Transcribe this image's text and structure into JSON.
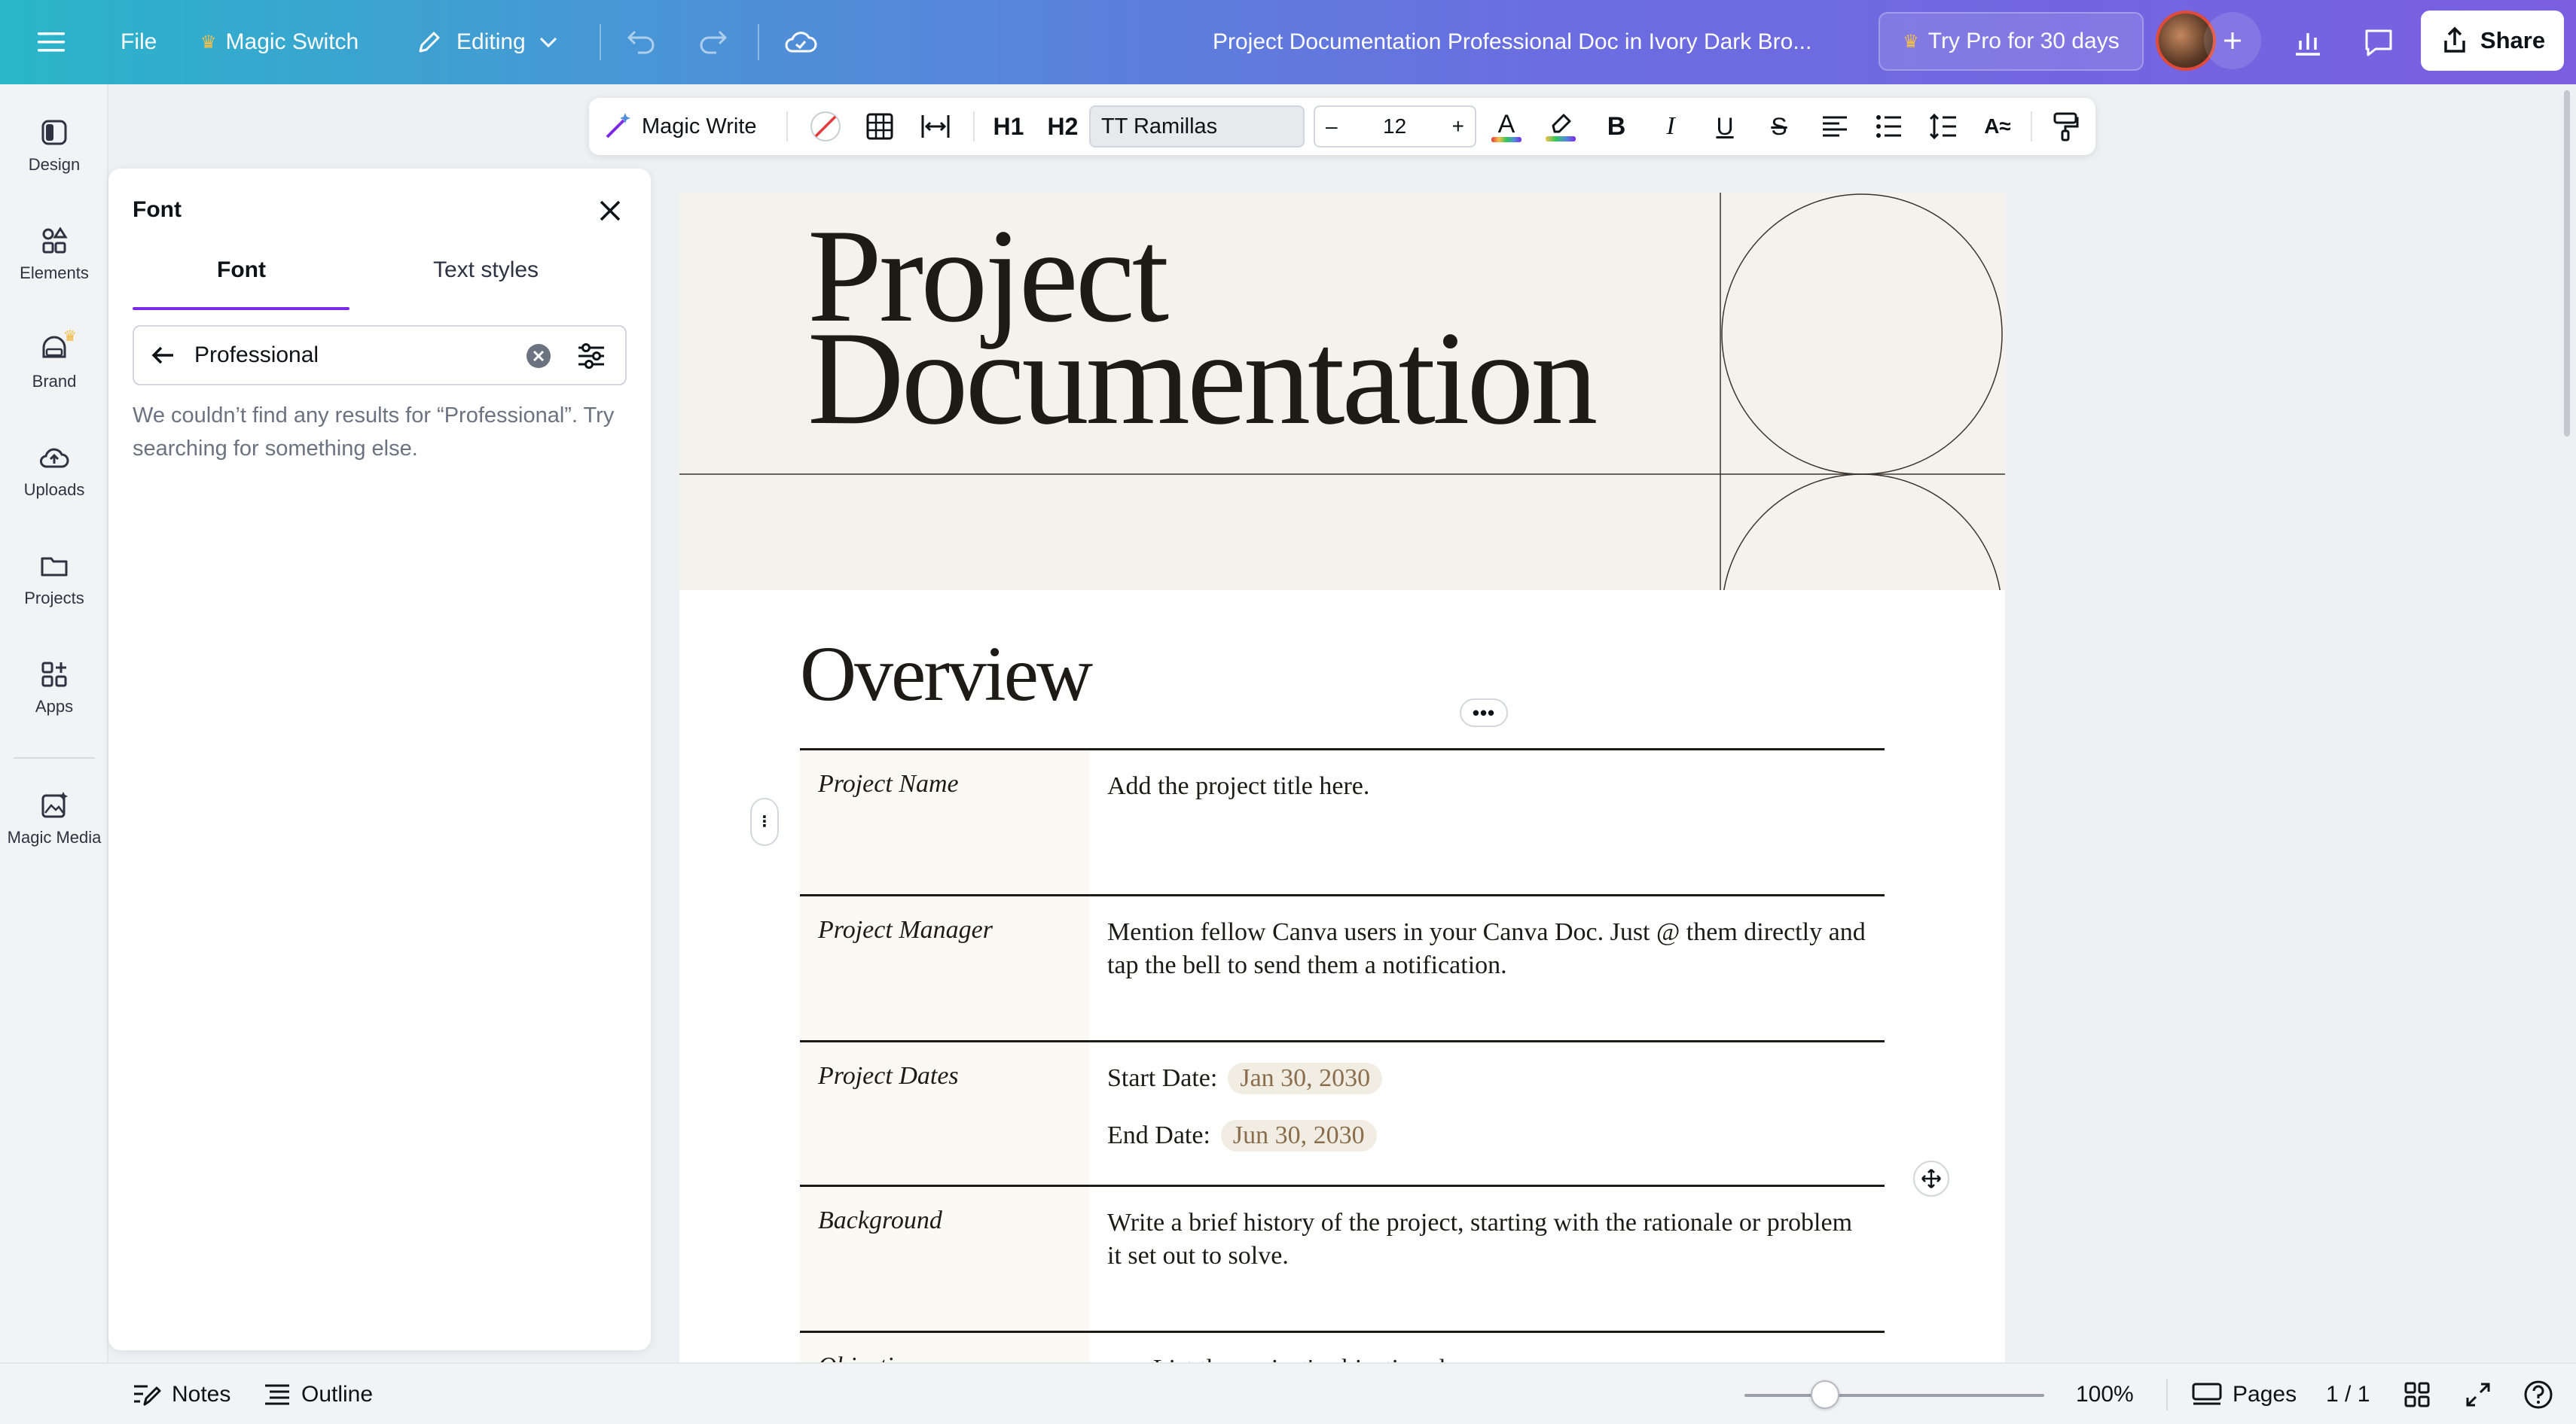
{
  "topbar": {
    "file_label": "File",
    "magic_switch_label": "Magic Switch",
    "editing_label": "Editing",
    "doc_title": "Project Documentation Professional Doc in Ivory Dark Bro...",
    "try_pro_label": "Try Pro for 30 days",
    "share_label": "Share"
  },
  "rail": {
    "items": [
      {
        "label": "Design",
        "icon": "design-icon"
      },
      {
        "label": "Elements",
        "icon": "elements-icon"
      },
      {
        "label": "Brand",
        "icon": "brand-icon"
      },
      {
        "label": "Uploads",
        "icon": "uploads-icon"
      },
      {
        "label": "Projects",
        "icon": "projects-icon"
      },
      {
        "label": "Apps",
        "icon": "apps-icon"
      },
      {
        "label": "Magic Media",
        "icon": "magic-media-icon"
      }
    ]
  },
  "font_panel": {
    "title": "Font",
    "tabs": [
      {
        "label": "Font",
        "active": true
      },
      {
        "label": "Text styles",
        "active": false
      }
    ],
    "search_value": "Professional",
    "no_results_message": "We couldn’t find any results for “Professional”. Try searching for something else."
  },
  "format_toolbar": {
    "magic_write_label": "Magic Write",
    "font_name": "TT Ramillas",
    "font_size": "12",
    "size_minus": "–",
    "size_plus": "+",
    "h1_label": "H1",
    "h2_label": "H2"
  },
  "document": {
    "hero_title_line1": "Project",
    "hero_title_line2": "Documentation",
    "overview_heading": "Overview",
    "rows": [
      {
        "label": "Project Name",
        "text": "Add the project title here."
      },
      {
        "label": "Project Manager",
        "text": "Mention fellow Canva users in your Canva Doc. Just @ them directly and tap the bell to send them a notification."
      },
      {
        "label": "Project Dates",
        "start_label": "Start Date:",
        "start_value": "Jan 30, 2030",
        "end_label": "End Date:",
        "end_value": "Jun 30, 2030"
      },
      {
        "label": "Background",
        "text": "Write a brief history of the project, starting with the rationale or problem it set out to solve."
      },
      {
        "label": "Objectives",
        "text": "List the project's objectives here."
      }
    ]
  },
  "bottombar": {
    "notes_label": "Notes",
    "outline_label": "Outline",
    "zoom_level": "100%",
    "zoom_fraction": 0.27,
    "pages_label": "Pages",
    "page_counter": "1 / 1"
  },
  "colors": {
    "accent_purple": "#7d2ae8",
    "hero_bg": "#f4f2ec",
    "date_chip_text": "#8a6d4c"
  }
}
